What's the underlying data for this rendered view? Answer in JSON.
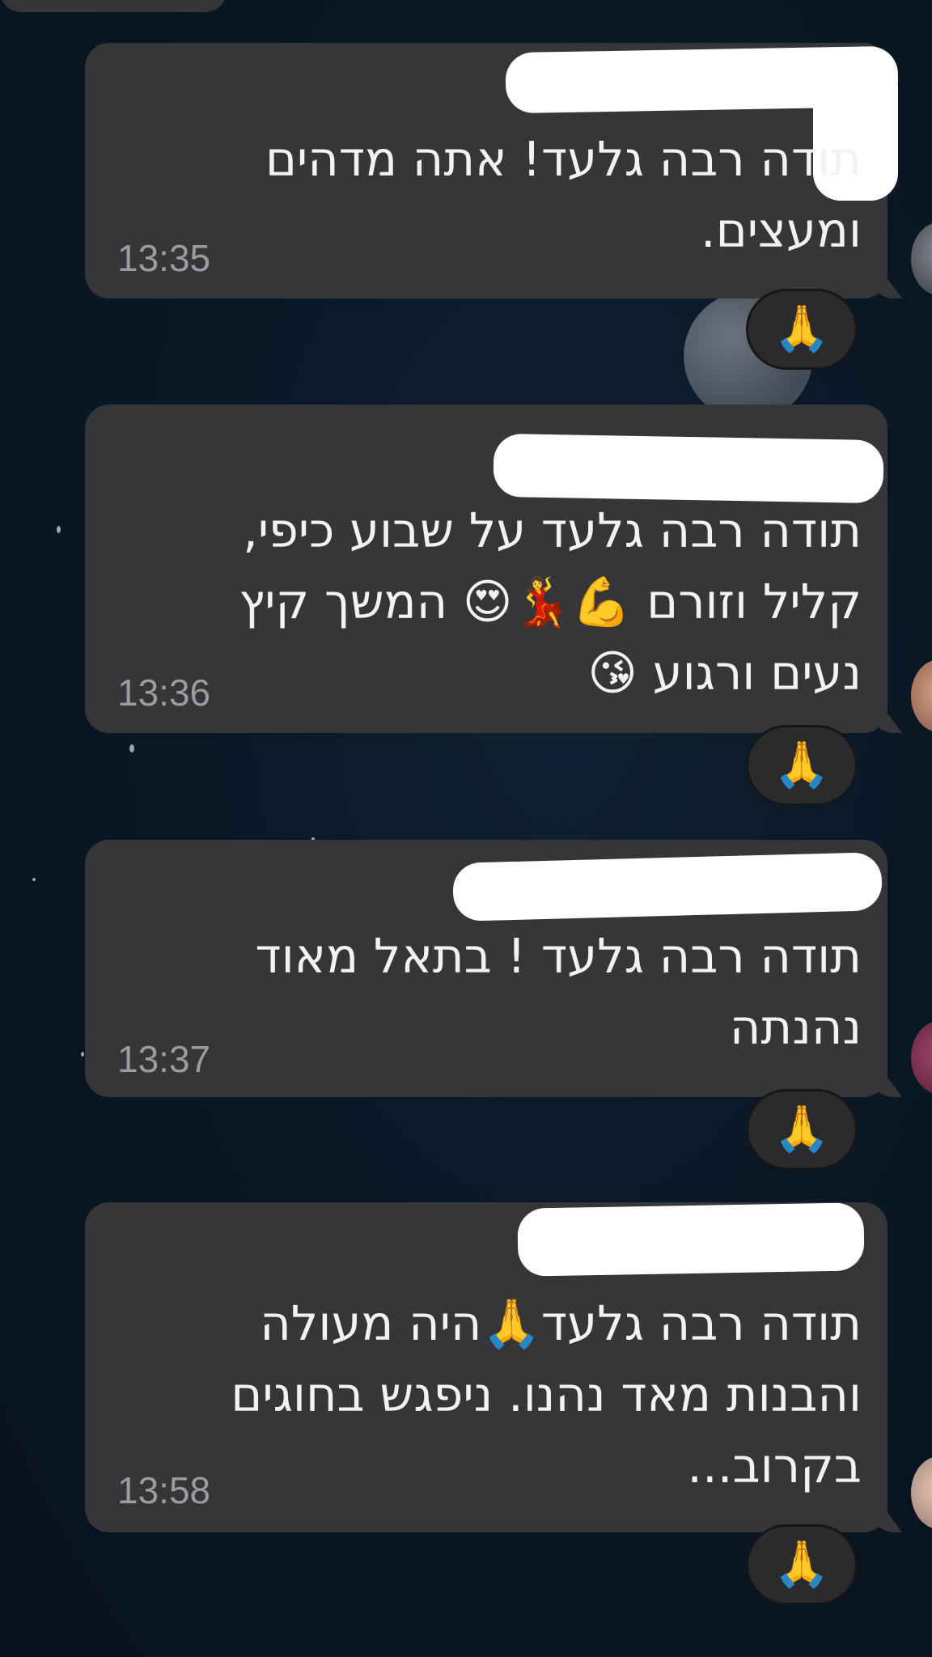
{
  "messages": [
    {
      "sender": "",
      "text_lines": [
        "תודה רבה גלעד! אתה מדהים",
        "ומעצים."
      ],
      "time": "13:35",
      "reaction": "🙏"
    },
    {
      "sender": "",
      "text_lines": [
        "תודה רבה גלעד על שבוע כיפי,",
        "קליל וזורם 💪💃😍 המשך קיץ",
        "נעים ורגוע 😘"
      ],
      "time": "13:36",
      "reaction": "🙏"
    },
    {
      "sender": "",
      "text_lines": [
        "תודה רבה גלעד ! בתאל מאוד",
        "נהנתה"
      ],
      "time": "13:37",
      "reaction": "🙏"
    },
    {
      "sender": "",
      "text_lines": [
        "תודה רבה גלעד🙏היה מעולה",
        "והבנות מאד נהנו. ניפגש בחוגים",
        "בקרוב..."
      ],
      "time": "13:58",
      "reaction": "🙏"
    }
  ],
  "colors": {
    "bubble": "#363638",
    "background": "#0a1826",
    "sender_1": "#e04fb8",
    "sender_2": "#3cc8e8",
    "sender_4": "#e3a51a",
    "time": "#9c9ca0",
    "text": "#f2f2f4"
  },
  "icons": {
    "reaction": "folded-hands-emoji",
    "avatar": "contact-avatar"
  }
}
